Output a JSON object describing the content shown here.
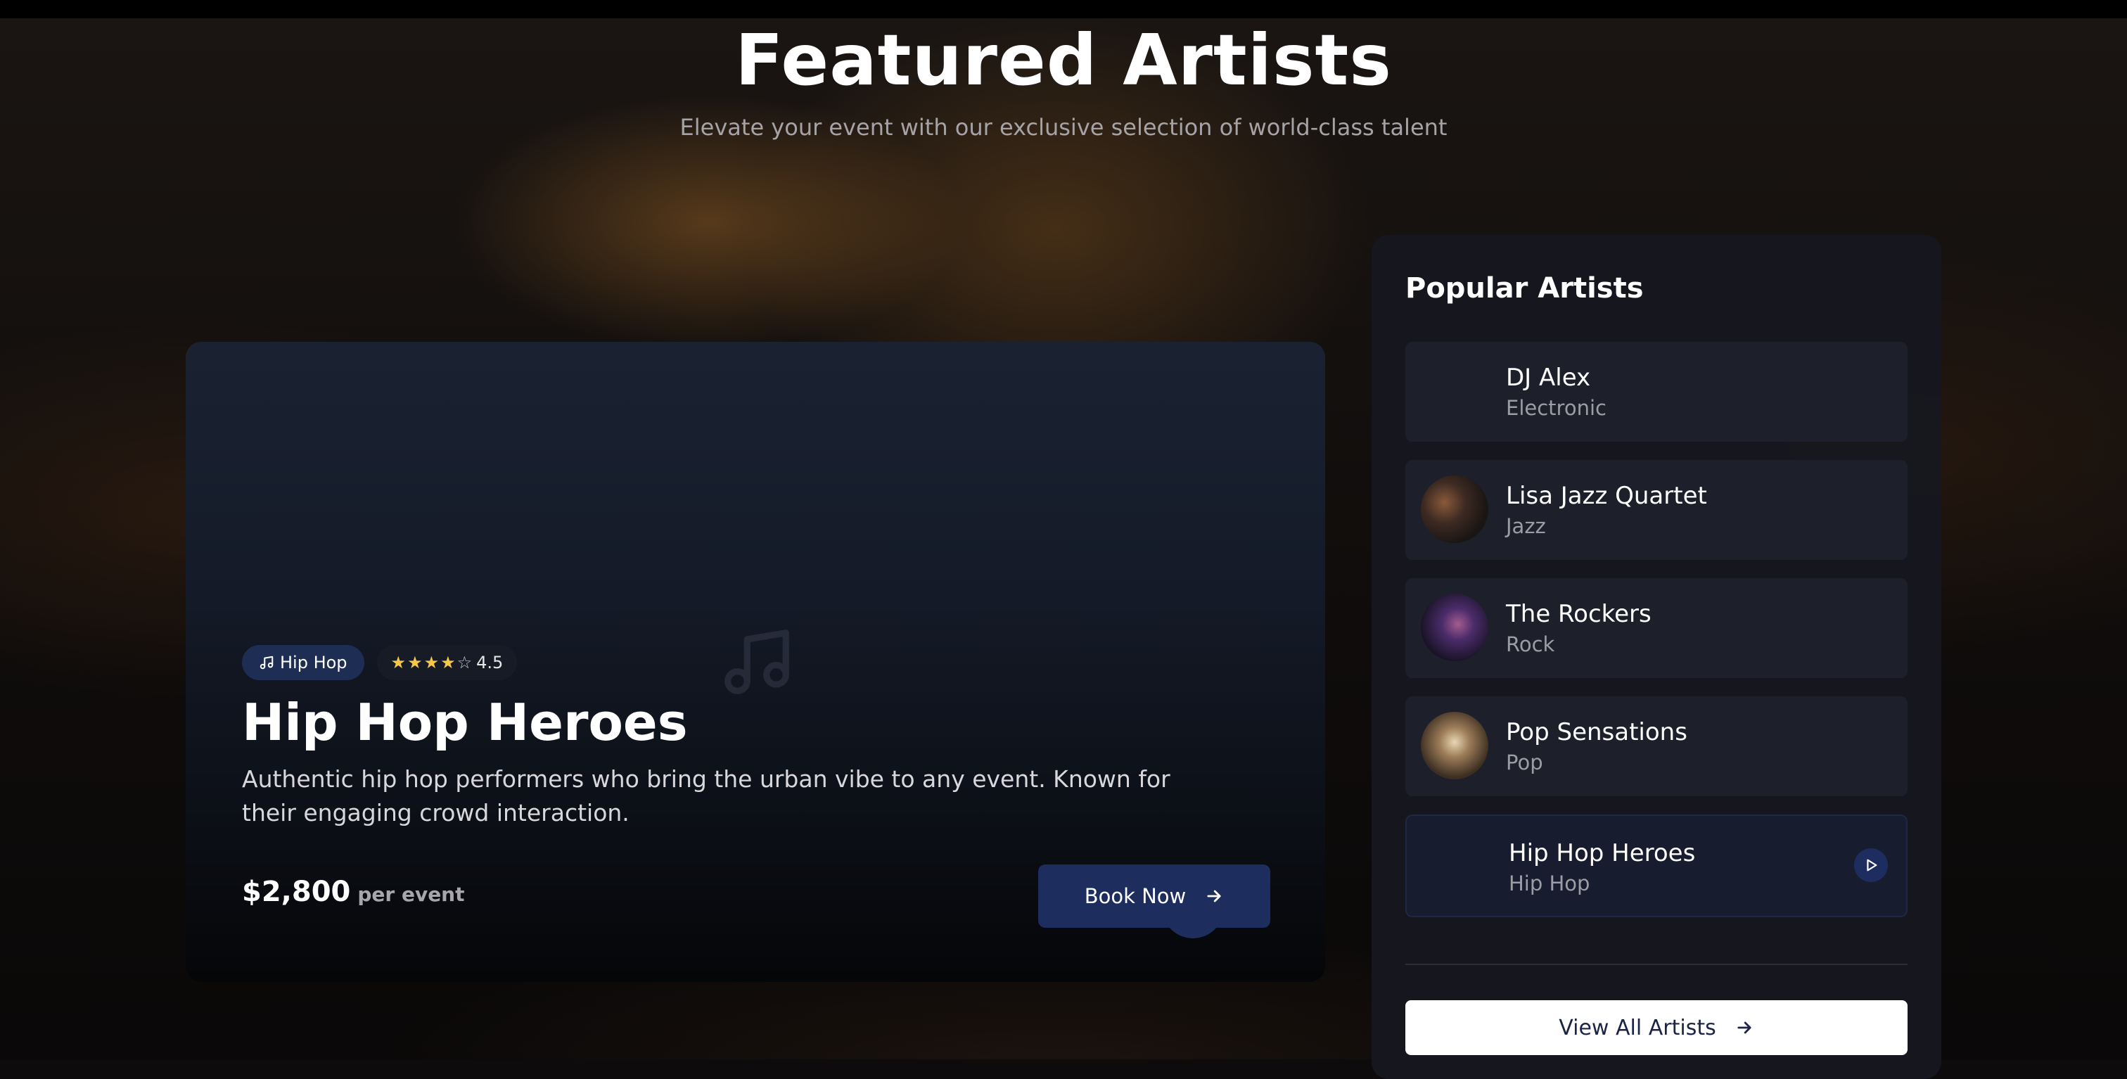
{
  "header": {
    "title": "Featured Artists",
    "subtitle": "Elevate your event with our exclusive selection of world-class talent"
  },
  "featured": {
    "genre": "Hip Hop",
    "rating": "4.5",
    "rating_value": 4.5,
    "rating_max": 5,
    "name": "Hip Hop Heroes",
    "description": "Authentic hip hop performers who bring the urban vibe to any event. Known for their engaging crowd interaction.",
    "price": "$2,800",
    "price_unit": "per event",
    "book_label": "Book Now"
  },
  "popular": {
    "title": "Popular Artists",
    "items": [
      {
        "name": "DJ Alex",
        "genre": "Electronic",
        "has_photo": false
      },
      {
        "name": "Lisa Jazz Quartet",
        "genre": "Jazz",
        "has_photo": true
      },
      {
        "name": "The Rockers",
        "genre": "Rock",
        "has_photo": true
      },
      {
        "name": "Pop Sensations",
        "genre": "Pop",
        "has_photo": true
      },
      {
        "name": "Hip Hop Heroes",
        "genre": "Hip Hop",
        "has_photo": false,
        "active": true
      }
    ],
    "view_all_label": "View All Artists"
  },
  "colors": {
    "accent": "#1d2d5e",
    "star": "#f5c84a"
  },
  "icons": {
    "genre": "music-note-icon",
    "book": "arrow-right-icon",
    "view_all": "arrow-right-icon",
    "play": "play-icon"
  }
}
